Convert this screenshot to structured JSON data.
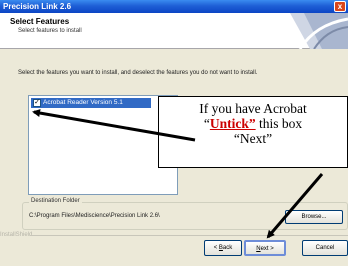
{
  "window": {
    "title": "Precision Link 2.6",
    "close_glyph": "x"
  },
  "header": {
    "title": "Select Features",
    "subtitle": "Select features to install"
  },
  "instruction": "Select the features you want to install, and deselect the features you do not want to install.",
  "features": [
    {
      "label": "Acrobat Reader Version 5.1",
      "checked": true,
      "selected": true,
      "check_glyph": "✓"
    }
  ],
  "destination": {
    "legend": "Destination Folder",
    "path": "C:\\Program Files\\Mediscience\\Precision Link 2.6\\",
    "browse_label": "Browse..."
  },
  "installshield_label": "InstallShield",
  "buttons": {
    "back_prefix": "< ",
    "back_key": "B",
    "back_rest": "ack",
    "next_key": "N",
    "next_rest": "ext >",
    "cancel_label": "Cancel"
  },
  "callout": {
    "line1": "If you have Acrobat",
    "line2_open": "“",
    "line2_emphasis": "Untick”",
    "line2_rest": " this box",
    "line3": "“Next”"
  },
  "colors": {
    "titlebar": "#0b45c4",
    "selection": "#316ac5",
    "emphasis": "#cc0000",
    "arrow": "#000000"
  }
}
